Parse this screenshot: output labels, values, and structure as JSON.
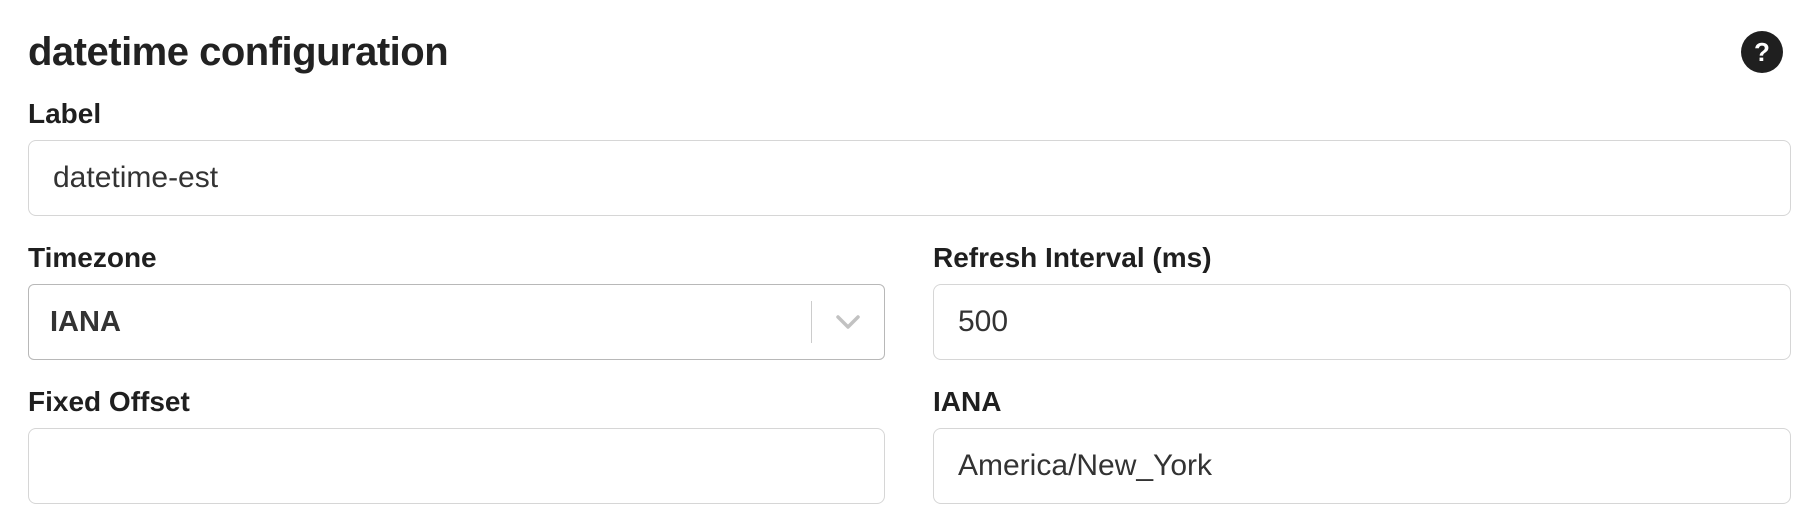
{
  "header": {
    "title": "datetime configuration",
    "help_icon_glyph": "?"
  },
  "fields": {
    "label": {
      "label": "Label",
      "value": "datetime-est"
    },
    "timezone": {
      "label": "Timezone",
      "selected": "IANA"
    },
    "refresh_interval": {
      "label": "Refresh Interval (ms)",
      "value": "500"
    },
    "fixed_offset": {
      "label": "Fixed Offset",
      "value": ""
    },
    "iana": {
      "label": "IANA",
      "value": "America/New_York"
    }
  },
  "icons": {
    "help": "help-icon",
    "dropdown": "chevron-down-icon"
  },
  "colors": {
    "text": "#222222",
    "border": "#d6d6d6",
    "select_border": "#b8b8b8",
    "help_bg": "#1f1f1f"
  }
}
